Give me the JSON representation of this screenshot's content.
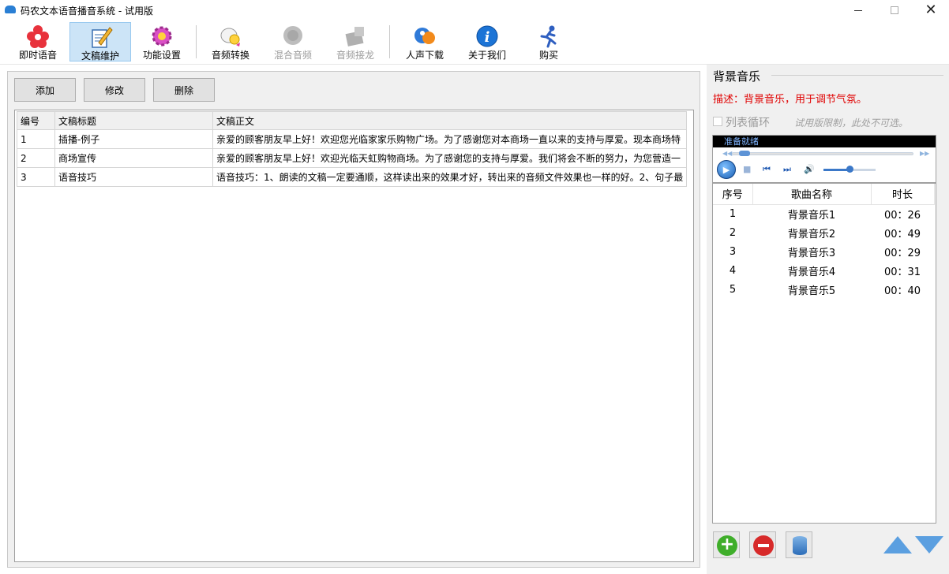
{
  "window": {
    "title": "码农文本语音播音系统 - 试用版"
  },
  "toolbar": {
    "items": [
      {
        "label": "即时语音",
        "active": false,
        "disabled": false,
        "icon": "flower-icon"
      },
      {
        "label": "文稿维护",
        "active": true,
        "disabled": false,
        "icon": "notepad-pencil-icon"
      },
      {
        "label": "功能设置",
        "active": false,
        "disabled": false,
        "icon": "gear-icon"
      },
      {
        "label": "音频转换",
        "active": false,
        "disabled": false,
        "icon": "audio-convert-icon"
      },
      {
        "label": "混合音频",
        "active": false,
        "disabled": true,
        "icon": "mix-audio-icon"
      },
      {
        "label": "音频接龙",
        "active": false,
        "disabled": true,
        "icon": "audio-chain-icon"
      },
      {
        "label": "人声下载",
        "active": false,
        "disabled": false,
        "icon": "voice-download-icon"
      },
      {
        "label": "关于我们",
        "active": false,
        "disabled": false,
        "icon": "info-icon"
      },
      {
        "label": "购买",
        "active": false,
        "disabled": false,
        "icon": "running-man-icon"
      }
    ]
  },
  "manuscripts": {
    "actions": {
      "add": "添加",
      "edit": "修改",
      "delete": "删除"
    },
    "columns": {
      "id": "编号",
      "title": "文稿标题",
      "body": "文稿正文"
    },
    "rows": [
      {
        "id": "1",
        "title": "插播-例子",
        "body": "亲爱的顾客朋友早上好！欢迎您光临家家乐购物广场。为了感谢您对本商场一直以来的支持与厚爱。现本商场特"
      },
      {
        "id": "2",
        "title": "商场宣传",
        "body": "亲爱的顾客朋友早上好！欢迎光临天虹购物商场。为了感谢您的支持与厚爱。我们将会不断的努力，为您营造一"
      },
      {
        "id": "3",
        "title": "语音技巧",
        "body": "语音技巧：1、朗读的文稿一定要通顺，这样读出来的效果才好，转出来的音频文件效果也一样的好。2、句子最"
      }
    ]
  },
  "bgm": {
    "title": "背景音乐",
    "description": "描述：背景音乐，用于调节气氛。",
    "loop_label": "列表循环",
    "loop_checked": false,
    "trial_note": "试用版限制，此处不可选。",
    "player": {
      "status": "准备就绪",
      "seek_fraction": 0.04,
      "volume_fraction": 0.5
    },
    "columns": {
      "index": "序号",
      "name": "歌曲名称",
      "duration": "时长"
    },
    "tracks": [
      {
        "index": "1",
        "name": "背景音乐1",
        "duration": "00：26"
      },
      {
        "index": "2",
        "name": "背景音乐2",
        "duration": "00：49"
      },
      {
        "index": "3",
        "name": "背景音乐3",
        "duration": "00：29"
      },
      {
        "index": "4",
        "name": "背景音乐4",
        "duration": "00：31"
      },
      {
        "index": "5",
        "name": "背景音乐5",
        "duration": "00：40"
      }
    ]
  },
  "colors": {
    "accent": "#cce4f7",
    "warning_text": "#e00000",
    "panel_bg": "#f0f0f0"
  }
}
